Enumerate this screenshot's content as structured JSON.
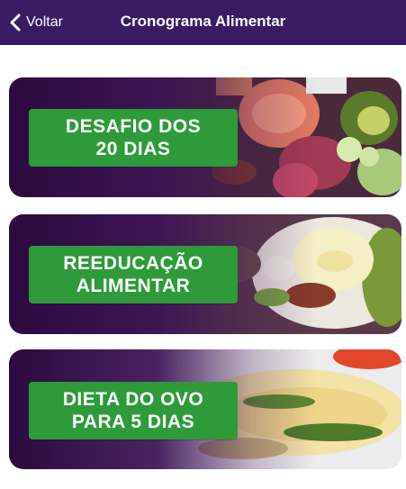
{
  "header": {
    "back_label": "Voltar",
    "title": "Cronograma Alimentar"
  },
  "cards": [
    {
      "line1": "DESAFIO DOS",
      "line2": "20 DIAS"
    },
    {
      "line1": "REEDUCAÇÃO",
      "line2": "ALIMENTAR"
    },
    {
      "line1": "DIETA DO OVO",
      "line2": "PARA 5 DIAS"
    }
  ],
  "colors": {
    "navbar": "#3a1a63",
    "card_overlay": "#3c1255",
    "button_green": "#2e9a3a"
  },
  "icons": {
    "back": "chevron-left-icon"
  }
}
